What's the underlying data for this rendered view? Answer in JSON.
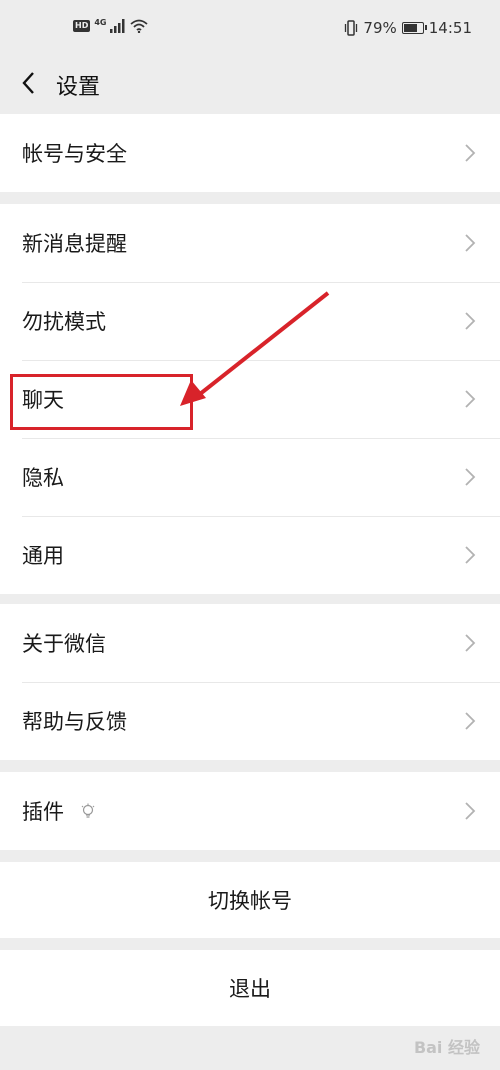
{
  "status_bar": {
    "network": "4G",
    "battery": "79%",
    "battery_level": 0.79,
    "time": "14:51"
  },
  "header": {
    "title": "设置"
  },
  "groups": [
    {
      "items": [
        {
          "label": "帐号与安全"
        }
      ]
    },
    {
      "items": [
        {
          "label": "新消息提醒"
        },
        {
          "label": "勿扰模式"
        },
        {
          "label": "聊天"
        },
        {
          "label": "隐私"
        },
        {
          "label": "通用"
        }
      ]
    },
    {
      "items": [
        {
          "label": "关于微信"
        },
        {
          "label": "帮助与反馈"
        }
      ]
    },
    {
      "items": [
        {
          "label": "插件"
        }
      ]
    }
  ],
  "actions": {
    "switch_account": "切换帐号",
    "logout": "退出"
  },
  "annotation": {
    "color": "#d8232a"
  },
  "watermark": {
    "text": "Bai 经验"
  }
}
